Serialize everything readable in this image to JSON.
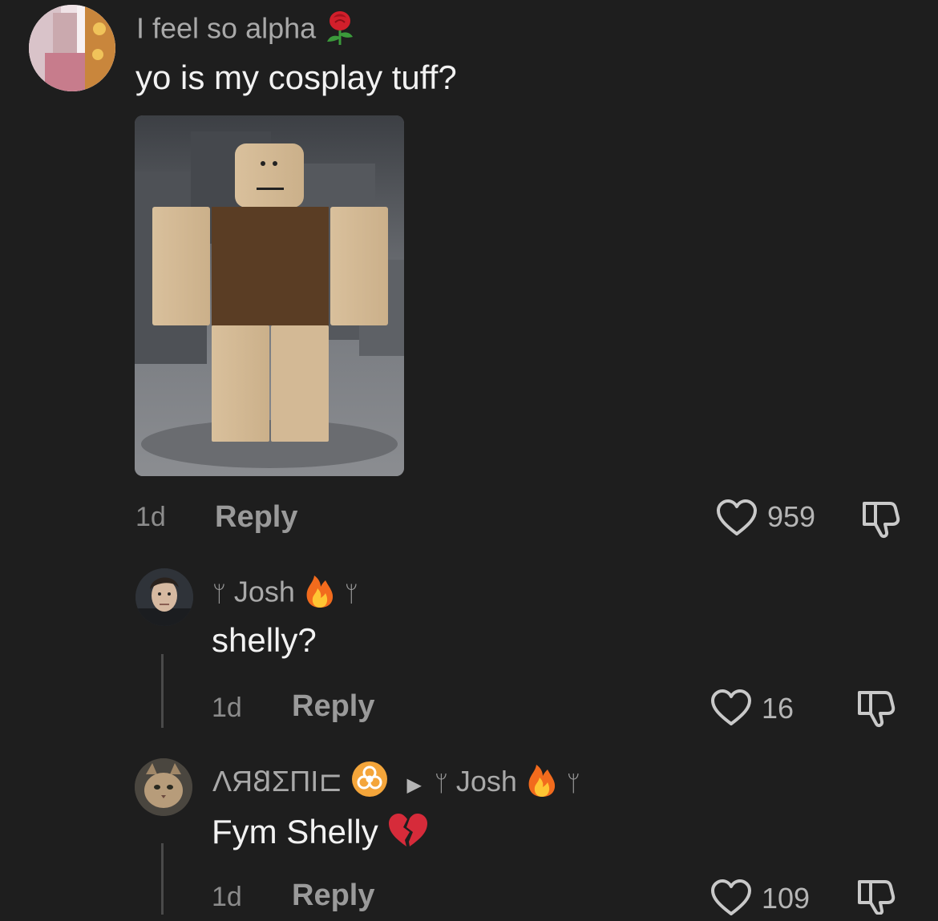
{
  "comments": [
    {
      "username": "I feel so alpha",
      "username_emoji": "rose-icon",
      "text": "yo is my cosplay tuff?",
      "time": "1d",
      "reply_label": "Reply",
      "likes": "959",
      "image": "roblox-noob-avatar"
    },
    {
      "username": "Josh",
      "username_prefix": "ᛘ",
      "username_suffix": "ᛘ",
      "username_emoji": "fire-icon",
      "text": "shelly?",
      "time": "1d",
      "reply_label": "Reply",
      "likes": "16"
    },
    {
      "username": "ΛЯ𐐒ΣΠI⊏",
      "username_emoji": "biohazard-icon",
      "reply_to": "Josh",
      "reply_to_prefix": "ᛘ",
      "reply_to_suffix": "ᛘ",
      "reply_to_emoji": "fire-icon",
      "text": "Fym Shelly",
      "text_emoji": "broken-heart-icon",
      "time": "1d",
      "reply_label": "Reply",
      "likes": "109"
    }
  ],
  "colors": {
    "background": "#1e1e1e",
    "username": "#a9a9a9",
    "text": "#f2f2f2",
    "meta": "#8c8c8c"
  }
}
